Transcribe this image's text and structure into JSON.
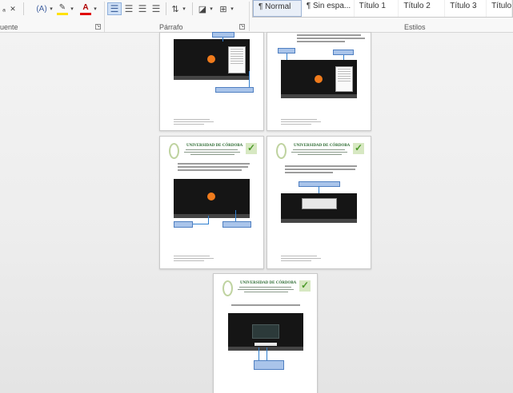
{
  "ribbon": {
    "font_group_label": "uente",
    "paragraph_group_label": "Párrafo",
    "styles_group_label": "Estilos",
    "tools": {
      "highlight_label": "A",
      "font_color_label": "A",
      "change_case_label": "Aa",
      "dropdown_glyph": "▾"
    },
    "styles": [
      "¶ Normal",
      "¶ Sin espa...",
      "Título 1",
      "Título 2",
      "Título 3",
      "Título"
    ]
  },
  "document": {
    "university_name": "UNIVERSIDAD DE CÓRDOBA"
  },
  "colors": {
    "accent_orange": "#f07b1c",
    "callout_blue": "#a9c4ea",
    "line_blue": "#2f7fd0"
  }
}
